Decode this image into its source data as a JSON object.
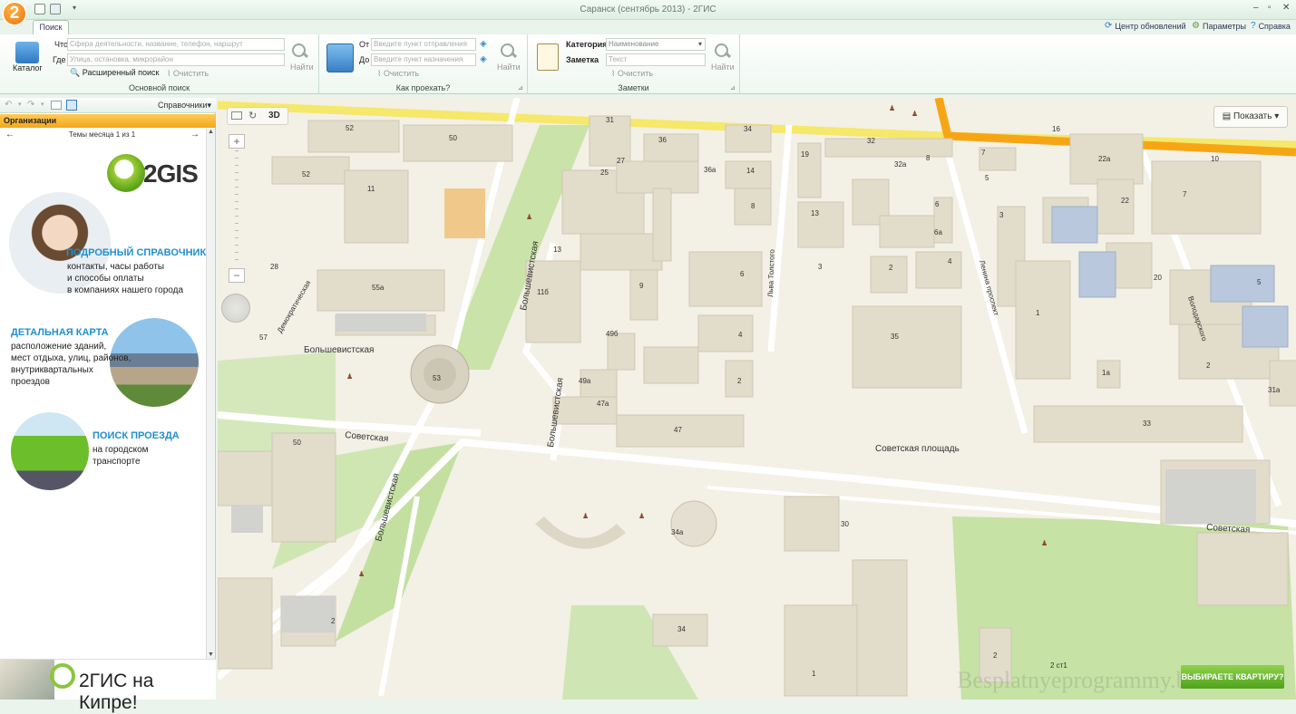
{
  "titlebar": {
    "logo": "2",
    "title": "Саранск (сентябрь 2013) - 2ГИС",
    "min": "–",
    "max": "▫",
    "close": "✕"
  },
  "tabs": {
    "search": "Поиск"
  },
  "toplinks": [
    {
      "icon": "refresh-icon",
      "label": "Центр обновлений"
    },
    {
      "icon": "gear-icon",
      "label": "Параметры"
    },
    {
      "icon": "help-icon",
      "label": "Справка"
    }
  ],
  "main_search": {
    "catalog_label": "Каталог",
    "what_label": "Что",
    "what_placeholder": "Сфера деятельности, название, телефон, наршрут",
    "where_label": "Где",
    "where_placeholder": "Улица, остановка, микрорайон",
    "find_label": "Найти",
    "advanced_label": "Расширенный поиск",
    "clear_label": "Очистить",
    "group_label": "Основной поиск"
  },
  "route": {
    "from_label": "От",
    "from_placeholder": "Введите пункт отправления",
    "to_label": "До",
    "to_placeholder": "Введите пункт назначения",
    "find_label": "Найти",
    "clear_label": "Очистить",
    "group_label": "Как проехать?"
  },
  "notes": {
    "category_label": "Категория",
    "category_value": "Наименование",
    "note_label": "Заметка",
    "note_placeholder": "Текст",
    "find_label": "Найти",
    "clear_label": "Очистить",
    "group_label": "Заметки"
  },
  "left_panel": {
    "directories_label": "Справочники",
    "org_header": "Организации",
    "themes": "Темы месяца 1 из 1",
    "brand": "2GIS",
    "promos": [
      {
        "title": "ПОДРОБНЫЙ СПРАВОЧНИК",
        "lines": [
          "контакты, часы работы",
          "и способы оплаты",
          "в компаниях нашего города"
        ]
      },
      {
        "title": "ДЕТАЛЬНАЯ КАРТА",
        "lines": [
          "расположение зданий,",
          "мест отдыха, улиц, районов,",
          "внутриквартальных",
          "проездов"
        ]
      },
      {
        "title": "ПОИСК ПРОЕЗДА",
        "lines": [
          "на городском",
          "транспорте"
        ]
      }
    ],
    "cyprus": "2ГИС на Кипре!"
  },
  "map": {
    "mode_3d": "3D",
    "show_label": "Показать",
    "apartment_btn": "ВЫБИРАЕТЕ КВАРТИРУ?",
    "watermark": "Besplatnyeprogrammy.biz",
    "streets": [
      "Большевистская",
      "Большевистская",
      "Большевистская",
      "Большевистская",
      "Советская",
      "Советская",
      "Демократическая",
      "Льва Толстого",
      "Ленина проспект",
      "Володарского"
    ],
    "square": "Советская площадь",
    "house_numbers": [
      "52",
      "50",
      "52",
      "11",
      "28",
      "55а",
      "57",
      "53",
      "50",
      "31",
      "25",
      "27",
      "36",
      "36а",
      "34",
      "14",
      "13",
      "11б",
      "9",
      "6",
      "8",
      "49б",
      "4",
      "49а",
      "47а",
      "47",
      "2",
      "19",
      "32",
      "32а",
      "8",
      "13",
      "6",
      "6а",
      "3",
      "2",
      "4",
      "35",
      "7",
      "16",
      "22а",
      "10",
      "5",
      "3",
      "22",
      "7",
      "1",
      "20",
      "5",
      "2",
      "1а",
      "33",
      "31а",
      "30",
      "34а",
      "34",
      "2",
      "1",
      "2",
      "2 ст1"
    ]
  }
}
